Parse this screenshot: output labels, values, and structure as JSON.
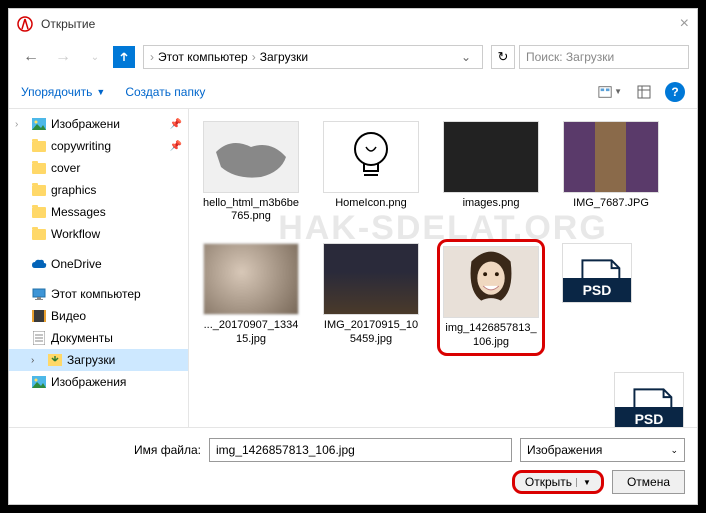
{
  "title": "Открытие",
  "breadcrumb": {
    "root": "Этот компьютер",
    "current": "Загрузки"
  },
  "search_placeholder": "Поиск: Загрузки",
  "toolbar": {
    "organize": "Упорядочить",
    "new_folder": "Создать папку"
  },
  "sidebar": {
    "items": [
      {
        "label": "Изображени",
        "icon": "pictures",
        "pinned": true,
        "chev": true
      },
      {
        "label": "copywriting",
        "icon": "folder",
        "pinned": true
      },
      {
        "label": "cover",
        "icon": "folder"
      },
      {
        "label": "graphics",
        "icon": "folder"
      },
      {
        "label": "Messages",
        "icon": "folder"
      },
      {
        "label": "Workflow",
        "icon": "folder"
      }
    ],
    "onedrive": "OneDrive",
    "thispc": "Этот компьютер",
    "pc_items": [
      {
        "label": "Видео",
        "icon": "video"
      },
      {
        "label": "Документы",
        "icon": "docs"
      },
      {
        "label": "Загрузки",
        "icon": "downloads",
        "selected": true
      },
      {
        "label": "Изображения",
        "icon": "pictures"
      }
    ]
  },
  "watermark": "HAK-SDELAT.ORG",
  "files": [
    {
      "name": "hello_html_m3b6be765.png",
      "thumb": "map"
    },
    {
      "name": "HomeIcon.png",
      "thumb": "bulb"
    },
    {
      "name": "images.png",
      "thumb": "icons"
    },
    {
      "name": "IMG_7687.JPG",
      "thumb": "brochure"
    },
    {
      "name": "..._20170907_133415.jpg",
      "thumb": "blur"
    },
    {
      "name": "IMG_20170915_105459.jpg",
      "thumb": "crowd"
    },
    {
      "name": "img_1426857813_106.jpg",
      "thumb": "woman",
      "highlighted": true
    },
    {
      "name": "",
      "thumb": "psd"
    },
    {
      "name": "",
      "thumb": "psd"
    }
  ],
  "footer": {
    "filename_label": "Имя файла:",
    "filename_value": "img_1426857813_106.jpg",
    "filter": "Изображения",
    "open": "Открыть",
    "cancel": "Отмена"
  }
}
